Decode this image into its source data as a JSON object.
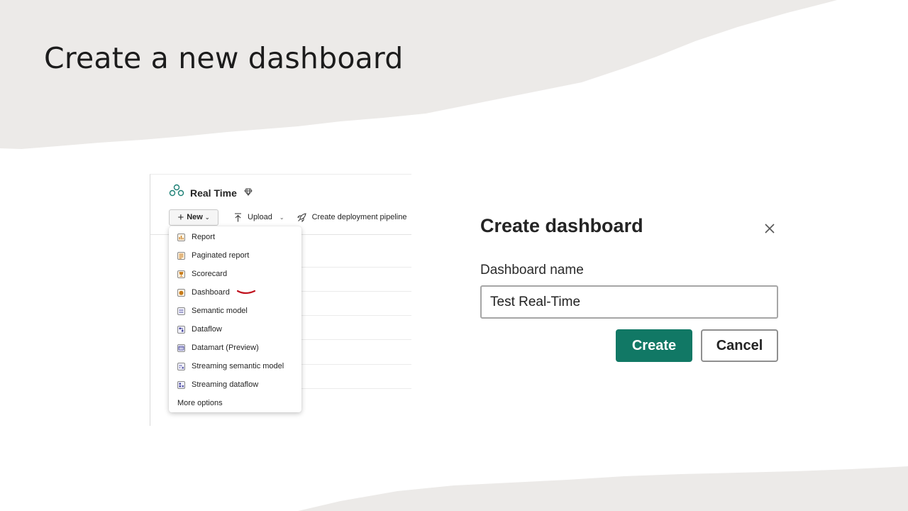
{
  "slide": {
    "title": "Create a new dashboard"
  },
  "workspace": {
    "title": "Real Time",
    "toolbar": {
      "new_label": "New",
      "upload_label": "Upload",
      "deploy_label": "Create deployment pipeline"
    },
    "new_menu": {
      "items": [
        {
          "label": "Report",
          "icon": "report-icon",
          "color": "#c77b1a"
        },
        {
          "label": "Paginated report",
          "icon": "paginated-report-icon",
          "color": "#c77b1a"
        },
        {
          "label": "Scorecard",
          "icon": "scorecard-icon",
          "color": "#c77b1a"
        },
        {
          "label": "Dashboard",
          "icon": "dashboard-icon",
          "color": "#c77b1a"
        },
        {
          "label": "Semantic model",
          "icon": "semantic-model-icon",
          "color": "#4a4aa0"
        },
        {
          "label": "Dataflow",
          "icon": "dataflow-icon",
          "color": "#4a4aa0"
        },
        {
          "label": "Datamart (Preview)",
          "icon": "datamart-icon",
          "color": "#4a4aa0"
        },
        {
          "label": "Streaming semantic model",
          "icon": "streaming-semantic-model-icon",
          "color": "#4a4aa0"
        },
        {
          "label": "Streaming dataflow",
          "icon": "streaming-dataflow-icon",
          "color": "#4a4aa0"
        }
      ],
      "more_label": "More options",
      "highlight_color": "#c0121e"
    }
  },
  "dialog": {
    "title": "Create dashboard",
    "name_label": "Dashboard name",
    "name_value": "Test Real-Time",
    "create_label": "Create",
    "cancel_label": "Cancel",
    "accent_color": "#117865"
  }
}
